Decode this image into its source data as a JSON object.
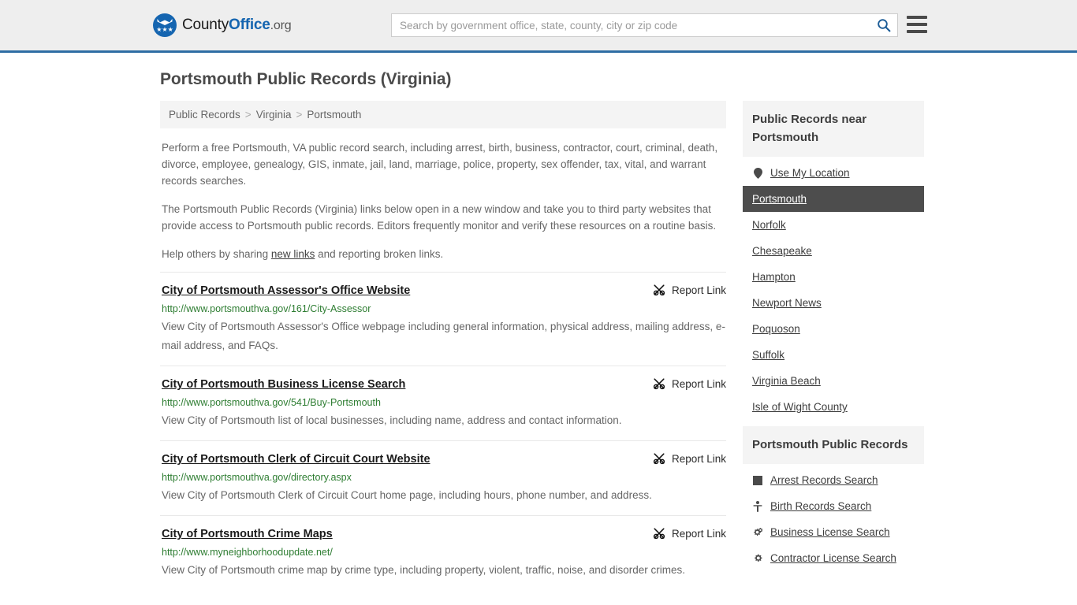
{
  "header": {
    "brand_name_1": "County",
    "brand_name_2": "Office",
    "brand_name_3": ".org",
    "logo_icon": "eagle-badge-icon",
    "logo_stars": "★★★",
    "search_placeholder": "Search by government office, state, county, city or zip code",
    "search_value": "",
    "search_icon": "search-icon",
    "menu_icon": "hamburger-menu-icon"
  },
  "page": {
    "title": "Portsmouth Public Records (Virginia)"
  },
  "breadcrumb": {
    "items": [
      {
        "label": "Public Records"
      },
      {
        "label": "Virginia"
      },
      {
        "label": "Portsmouth"
      }
    ],
    "separator": ">"
  },
  "intro": {
    "paragraph_1": "Perform a free Portsmouth, VA public record search, including arrest, birth, business, contractor, court, criminal, death, divorce, employee, genealogy, GIS, inmate, jail, land, marriage, police, property, sex offender, tax, vital, and warrant records searches.",
    "paragraph_2": "The Portsmouth Public Records (Virginia) links below open in a new window and take you to third party websites that provide access to Portsmouth public records. Editors frequently monitor and verify these resources on a routine basis.",
    "help_prefix": "Help others by sharing ",
    "help_link": "new links",
    "help_suffix": " and reporting broken links."
  },
  "report_link_label": "Report Link",
  "report_link_icon": "broken-link-icon",
  "results": [
    {
      "title": "City of Portsmouth Assessor's Office Website",
      "url": "http://www.portsmouthva.gov/161/City-Assessor",
      "description": "View City of Portsmouth Assessor's Office webpage including general information, physical address, mailing address, e-mail address, and FAQs."
    },
    {
      "title": "City of Portsmouth Business License Search",
      "url": "http://www.portsmouthva.gov/541/Buy-Portsmouth",
      "description": "View City of Portsmouth list of local businesses, including name, address and contact information."
    },
    {
      "title": "City of Portsmouth Clerk of Circuit Court Website",
      "url": "http://www.portsmouthva.gov/directory.aspx",
      "description": "View City of Portsmouth Clerk of Circuit Court home page, including hours, phone number, and address."
    },
    {
      "title": "City of Portsmouth Crime Maps",
      "url": "http://www.myneighborhoodupdate.net/",
      "description": "View City of Portsmouth crime map by crime type, including property, violent, traffic, noise, and disorder crimes."
    }
  ],
  "sidebar": {
    "nearby": {
      "heading": "Public Records near Portsmouth",
      "items": [
        {
          "label": "Use My Location",
          "icon": "map-pin-icon",
          "active": false
        },
        {
          "label": "Portsmouth",
          "icon": "",
          "active": true
        },
        {
          "label": "Norfolk",
          "icon": "",
          "active": false
        },
        {
          "label": "Chesapeake",
          "icon": "",
          "active": false
        },
        {
          "label": "Hampton",
          "icon": "",
          "active": false
        },
        {
          "label": "Newport News",
          "icon": "",
          "active": false
        },
        {
          "label": "Poquoson",
          "icon": "",
          "active": false
        },
        {
          "label": "Suffolk",
          "icon": "",
          "active": false
        },
        {
          "label": "Virginia Beach",
          "icon": "",
          "active": false
        },
        {
          "label": "Isle of Wight County",
          "icon": "",
          "active": false
        }
      ]
    },
    "records": {
      "heading": "Portsmouth Public Records",
      "items": [
        {
          "label": "Arrest Records Search",
          "icon": "square-icon"
        },
        {
          "label": "Birth Records Search",
          "icon": "person-icon"
        },
        {
          "label": "Business License Search",
          "icon": "double-gear-icon"
        },
        {
          "label": "Contractor License Search",
          "icon": "gear-icon"
        }
      ]
    }
  },
  "colors": {
    "header_bg": "#eeeeee",
    "header_border": "#2e6da4",
    "brand_blue": "#1565b0",
    "url_green": "#2e7d32",
    "active_item_bg": "#4d4d4d",
    "panel_bg": "#f4f4f4",
    "body_text": "#666666"
  }
}
